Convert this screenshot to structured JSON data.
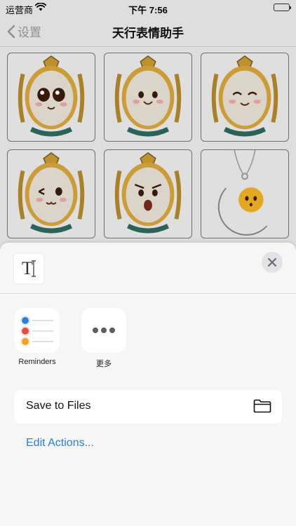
{
  "status_bar": {
    "carrier": "运营商",
    "time": "下午 7:56"
  },
  "nav": {
    "back_label": "设置",
    "title": "天行表情助手"
  },
  "grid": {
    "items": [
      {
        "expression": "big-eyes-smile"
      },
      {
        "expression": "happy"
      },
      {
        "expression": "laughing"
      },
      {
        "expression": "wink"
      },
      {
        "expression": "angry"
      },
      {
        "expression": "moon-pendant"
      }
    ]
  },
  "share_sheet": {
    "file_preview_glyph": "T",
    "apps": [
      {
        "label": "Reminders",
        "icon": "reminders-icon"
      },
      {
        "label": "更多",
        "icon": "more-icon"
      }
    ],
    "actions": [
      {
        "label": "Save to Files",
        "icon": "folder-icon"
      }
    ],
    "edit_actions_label": "Edit Actions..."
  },
  "colors": {
    "link": "#2a7de1",
    "reminder_dots": [
      "#2d7ee0",
      "#e74a3b",
      "#f2a026"
    ]
  }
}
